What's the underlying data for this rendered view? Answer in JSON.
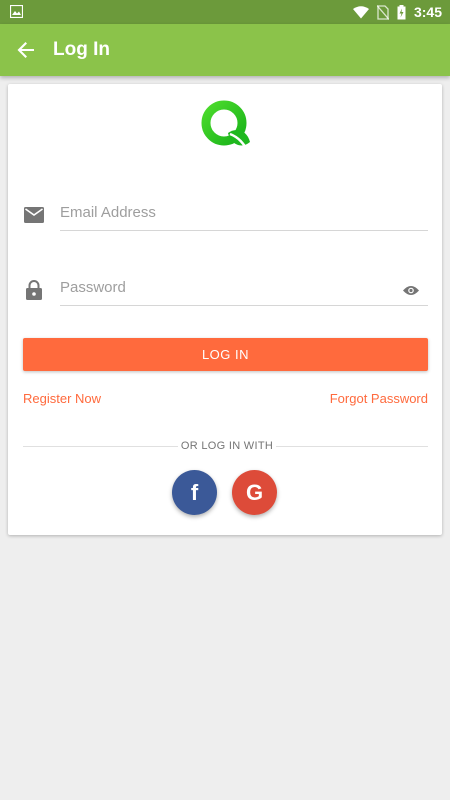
{
  "status_bar": {
    "time": "3:45",
    "icons": [
      "image-icon",
      "wifi-icon",
      "no-sim-icon",
      "battery-charging-icon"
    ]
  },
  "app_bar": {
    "title": "Log In",
    "back_icon": "arrow-back-icon",
    "color": "#8bc34a"
  },
  "form": {
    "email_placeholder": "Email Address",
    "email_value": "",
    "password_placeholder": "Password",
    "password_value": "",
    "email_icon": "mail-icon",
    "password_icon": "lock-icon",
    "visibility_icon": "eye-icon"
  },
  "actions": {
    "login_label": "LOG IN",
    "register_label": "Register Now",
    "forgot_label": "Forgot Password",
    "accent": "#ff6a3d"
  },
  "social": {
    "divider_text": "OR LOG IN WITH",
    "facebook_label": "f",
    "google_label": "G",
    "facebook_color": "#3b5998",
    "google_color": "#dd4b39"
  }
}
